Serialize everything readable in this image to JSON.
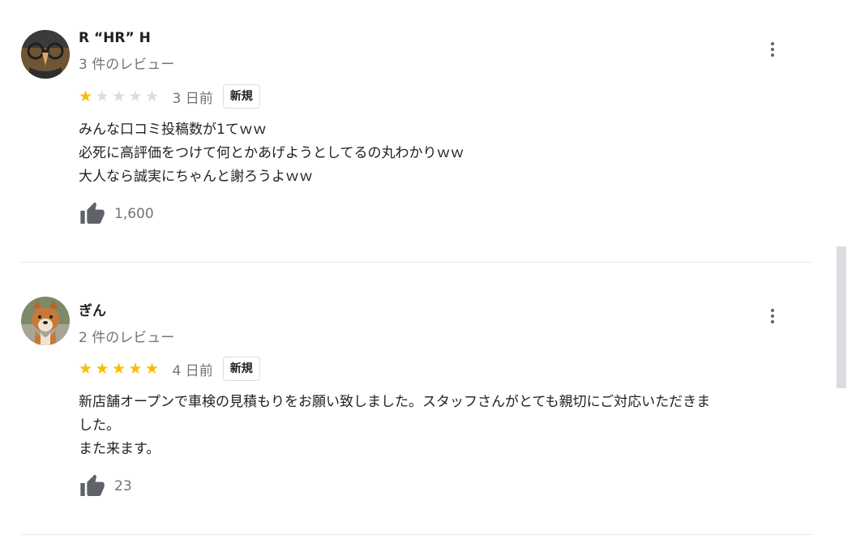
{
  "reviews": [
    {
      "author": "R “HR” H",
      "review_count": "3 件のレビュー",
      "rating": 1,
      "date": "3 日前",
      "badge": "新規",
      "lines": [
        "みんな口コミ投稿数が1てｗｗ",
        "必死に高評価をつけて何とかあげようとしてるの丸わかりｗｗ",
        "大人なら誠実にちゃんと謝ろうよｗｗ"
      ],
      "likes": "1,600"
    },
    {
      "author": "ぎん",
      "review_count": "2 件のレビュー",
      "rating": 5,
      "date": "4 日前",
      "badge": "新規",
      "lines": [
        "新店舗オープンで車検の見積もりをお願い致しました。スタッフさんがとても親切にご対応いただきま",
        "した。",
        "また来ます。"
      ],
      "likes": "23"
    }
  ],
  "colors": {
    "star_on": "#fbbc04",
    "star_off": "#dadce0",
    "secondary_text": "#70757a",
    "icon": "#5f6368"
  },
  "icons": {
    "more": "more-vert-icon",
    "like": "thumb-up-icon",
    "star": "star-icon"
  }
}
